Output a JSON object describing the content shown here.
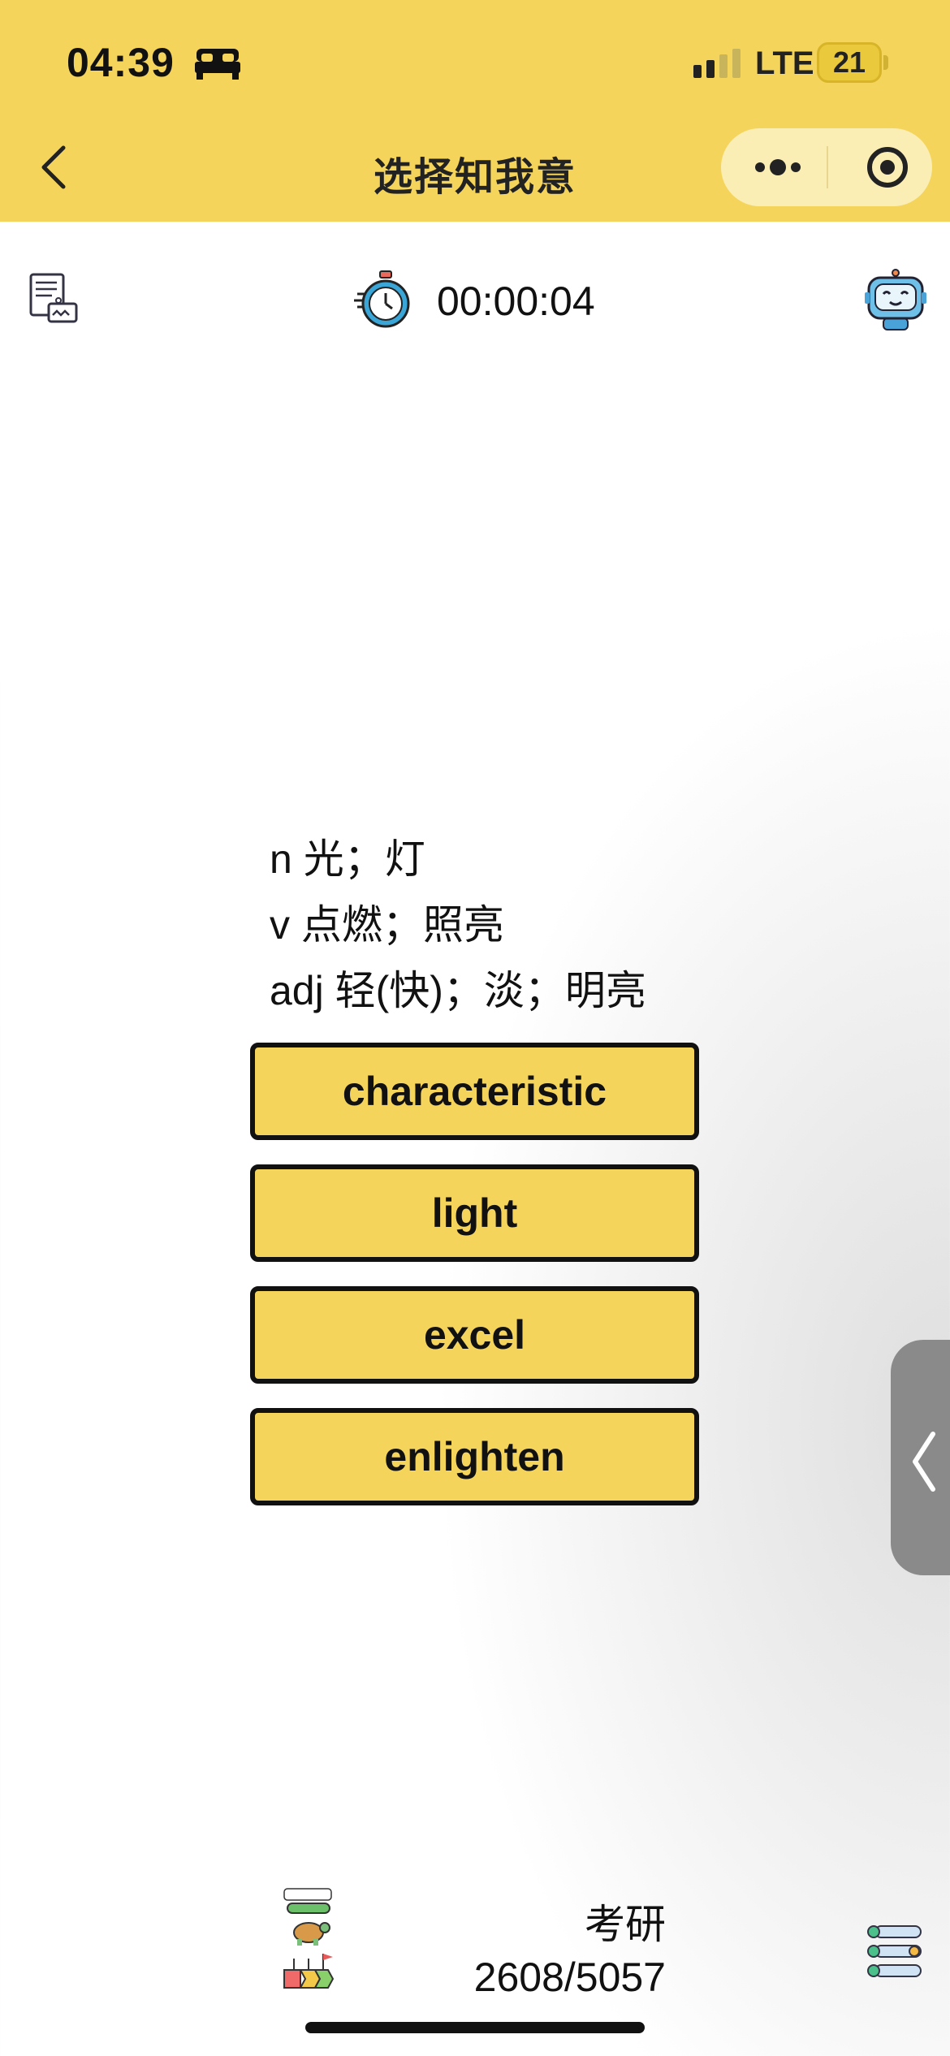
{
  "status_bar": {
    "time": "04:39",
    "network": "LTE",
    "battery": "21"
  },
  "nav": {
    "title": "选择知我意"
  },
  "timer": {
    "elapsed": "00:00:04"
  },
  "question": {
    "definitions": [
      "n 光；灯",
      "v 点燃；照亮",
      "adj 轻(快)；淡；明亮"
    ]
  },
  "options": [
    "characteristic",
    "light",
    "excel",
    "enlighten"
  ],
  "footer": {
    "category": "考研",
    "progress_text": "2608/5057"
  },
  "icons": {
    "sleep": "bed-icon",
    "signal": "signal-icon",
    "back": "chevron-left-icon",
    "more": "more-dots-icon",
    "close": "target-icon",
    "notes": "paper-icon",
    "timer": "stopwatch-icon",
    "assistant": "robot-icon",
    "drawer": "chevron-left-icon",
    "level": "level-up-icon",
    "list": "list-icon"
  },
  "colors": {
    "accent": "#f5d45c",
    "capsule": "#fbeeb5",
    "border": "#111111"
  }
}
